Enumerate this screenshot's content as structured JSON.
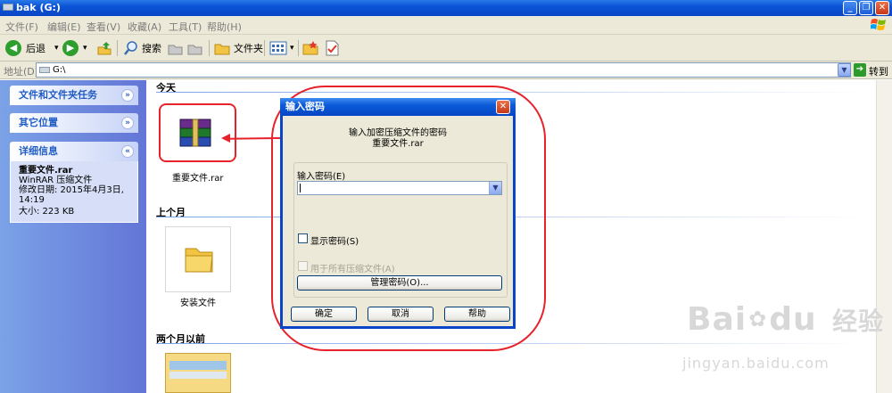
{
  "window": {
    "title": "bak (G:)",
    "min": "_",
    "max": "❐",
    "close": "✕"
  },
  "menu": [
    "文件(F)",
    "编辑(E)",
    "查看(V)",
    "收藏(A)",
    "工具(T)",
    "帮助(H)"
  ],
  "toolbar": {
    "back": "后退",
    "forward_dd": "▾",
    "back_dd": "▾",
    "search": "搜索",
    "folders": "文件夹",
    "views_dd": "▾"
  },
  "address": {
    "label": "地址(D)",
    "value": "G:\\",
    "go": "转到"
  },
  "tasks": {
    "file_tasks": "文件和文件夹任务",
    "other_places": "其它位置",
    "details": "详细信息",
    "details_name": "重要文件.rar",
    "details_type": "WinRAR 压缩文件",
    "details_modified": "修改日期: 2015年4月3日, 14:19",
    "details_size": "大小: 223 KB"
  },
  "groups": {
    "today": "今天",
    "last_month": "上个月",
    "two_months": "两个月以前"
  },
  "files": {
    "rar_name": "重要文件.rar",
    "folder_name": "安装文件"
  },
  "dialog": {
    "title": "输入密码",
    "message_line1": "输入加密压缩文件的密码",
    "message_line2": "重要文件.rar",
    "password_label": "输入密码(E)",
    "password_value": "",
    "show_password": "显示密码(S)",
    "use_all": "用于所有压缩文件(A)",
    "manage": "管理密码(O)...",
    "ok": "确定",
    "cancel": "取消",
    "help": "帮助"
  },
  "watermark": {
    "brand": "Bai",
    "brand2": "du",
    "cn": "经验",
    "url": "jingyan.baidu.com"
  }
}
